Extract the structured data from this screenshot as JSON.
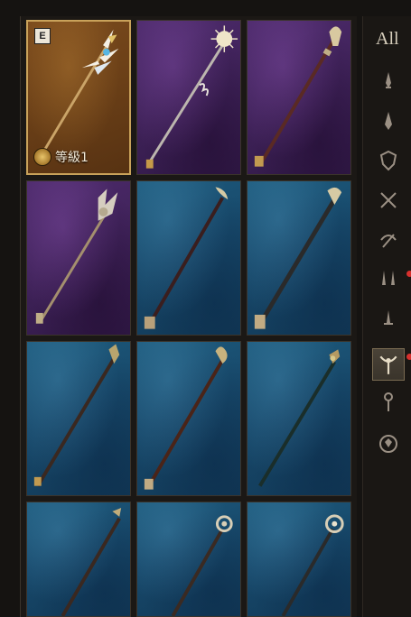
{
  "sidebar": {
    "all_label": "All",
    "categories": [
      {
        "icon": "dagger-icon"
      },
      {
        "icon": "claw-icon"
      },
      {
        "icon": "shield-icon"
      },
      {
        "icon": "crossed-swords-icon"
      },
      {
        "icon": "crossbow-icon"
      },
      {
        "icon": "daggers-icon"
      },
      {
        "icon": "sword-icon"
      },
      {
        "icon": "staff-icon",
        "active": true
      },
      {
        "icon": "wand-icon"
      },
      {
        "icon": "orb-icon"
      }
    ]
  },
  "grid": {
    "items": [
      {
        "rarity": "gold",
        "equipped_badge": "E",
        "level_label": "等級1",
        "selected": true
      },
      {
        "rarity": "purple"
      },
      {
        "rarity": "purple"
      },
      {
        "rarity": "purple"
      },
      {
        "rarity": "blue"
      },
      {
        "rarity": "blue"
      },
      {
        "rarity": "blue"
      },
      {
        "rarity": "blue"
      },
      {
        "rarity": "blue"
      },
      {
        "rarity": "blue"
      },
      {
        "rarity": "blue"
      },
      {
        "rarity": "blue"
      }
    ]
  },
  "colors": {
    "gold_frame": "#c9a25a",
    "blue_bg": "#17486a",
    "purple_bg": "#3f2259",
    "gold_bg": "#6a3f17",
    "notification": "#d8302d"
  }
}
